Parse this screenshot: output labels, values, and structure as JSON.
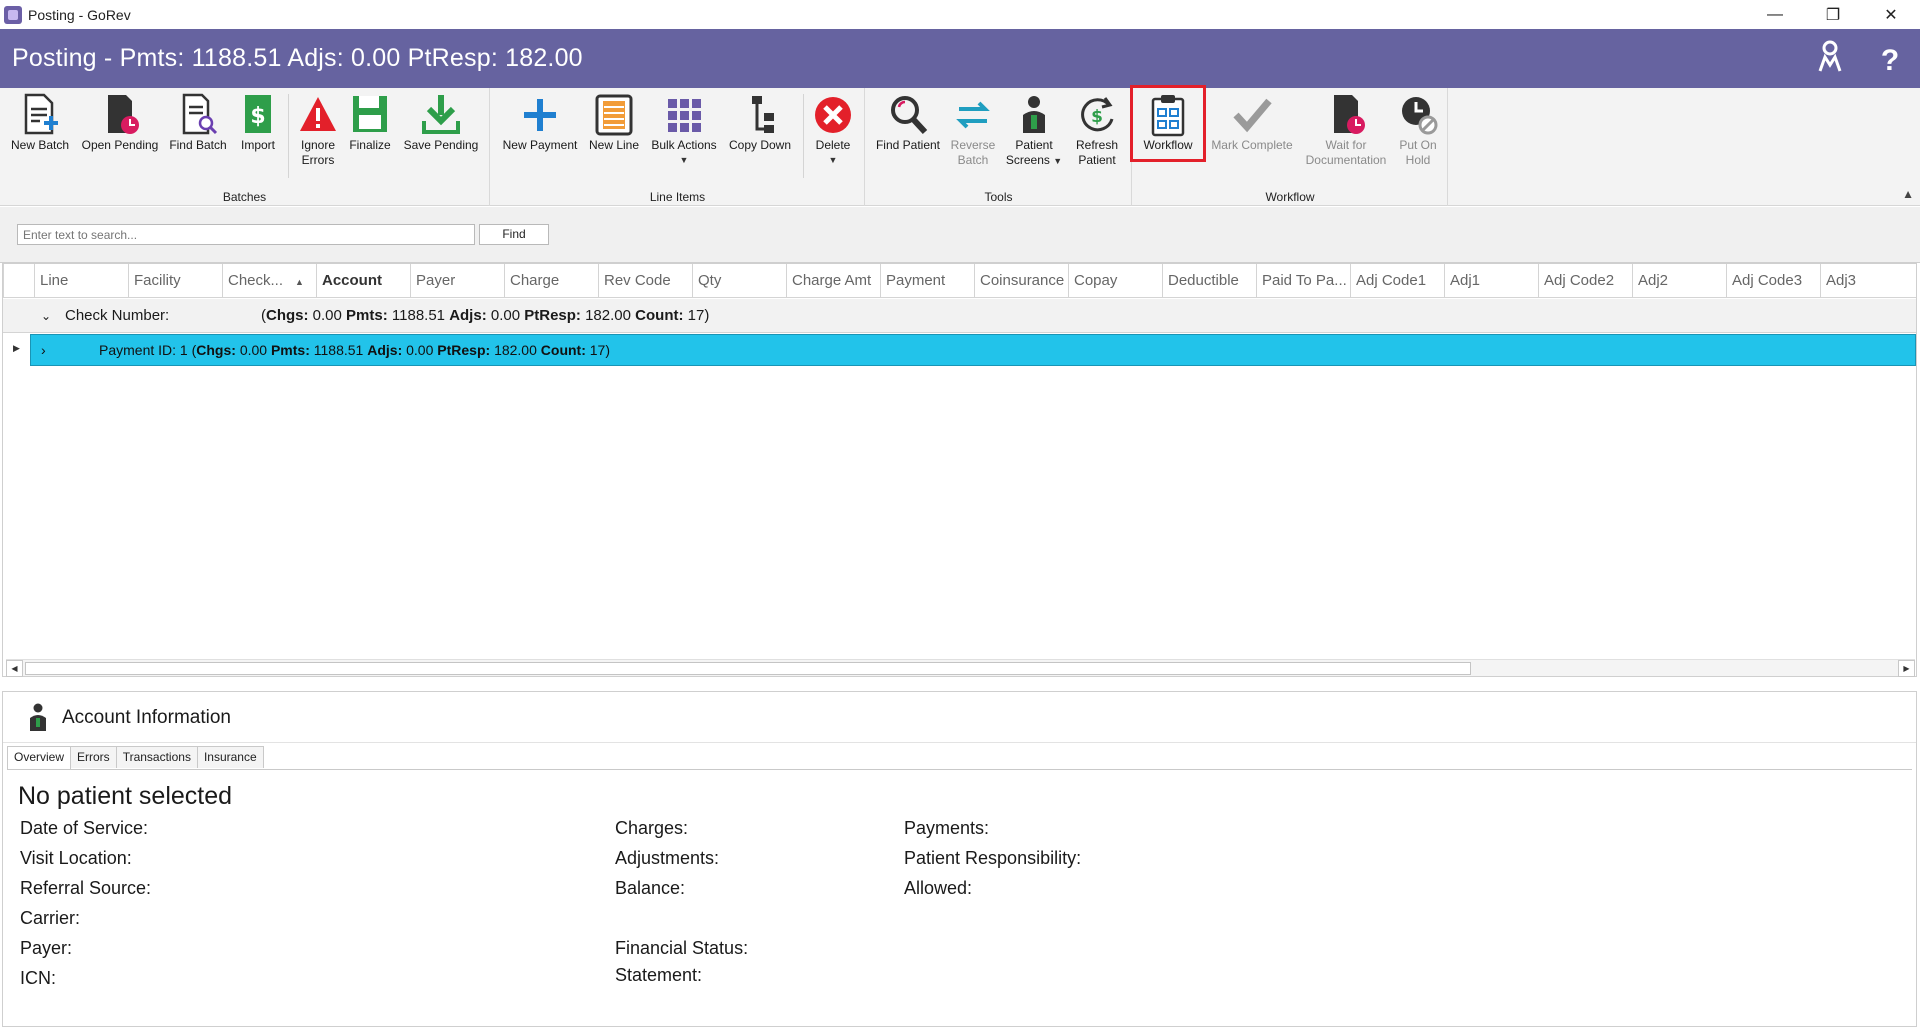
{
  "window": {
    "title": "Posting - GoRev",
    "controls": [
      "—",
      "❐",
      "✕"
    ]
  },
  "header": {
    "title": "Posting - Pmts: 1188.51 Adjs: 0.00 PtResp: 182.00",
    "icons": [
      "users-icon",
      "help-icon"
    ],
    "help_glyph": "?"
  },
  "ribbon": {
    "groups": {
      "batches": "Batches",
      "line_items": "Line Items",
      "tools": "Tools",
      "workflow": "Workflow"
    },
    "buttons": {
      "new_batch": "New Batch",
      "open_pending": "Open Pending",
      "find_batch": "Find Batch",
      "import": "Import",
      "ignore_errors_1": "Ignore",
      "ignore_errors_2": "Errors",
      "finalize": "Finalize",
      "save_pending": "Save Pending",
      "new_payment": "New Payment",
      "new_line": "New Line",
      "bulk_actions": "Bulk Actions",
      "copy_down": "Copy Down",
      "delete": "Delete",
      "find_patient": "Find Patient",
      "reverse_batch_1": "Reverse",
      "reverse_batch_2": "Batch",
      "patient_screens_1": "Patient",
      "patient_screens_2": "Screens",
      "refresh_patient_1": "Refresh",
      "refresh_patient_2": "Patient",
      "workflow": "Workflow",
      "mark_complete": "Mark Complete",
      "wait_doc_1": "Wait for",
      "wait_doc_2": "Documentation",
      "put_on_hold_1": "Put On",
      "put_on_hold_2": "Hold"
    },
    "colors": {
      "header_bg": "#6663a0",
      "selected_row": "#22c3ea",
      "highlight_outline": "#e3202a",
      "delete_red": "#e3202a",
      "finalize_green": "#2e9e4a",
      "blue_action": "#1f7fd0"
    }
  },
  "search": {
    "placeholder": "Enter text to search...",
    "find_label": "Find"
  },
  "grid": {
    "columns": [
      "Line",
      "Facility",
      "Check...",
      "Account",
      "Payer",
      "Charge",
      "Rev Code",
      "Qty",
      "Charge Amt",
      "Payment",
      "Coinsurance",
      "Copay",
      "Deductible",
      "Paid To Pa...",
      "Adj Code1",
      "Adj1",
      "Adj Code2",
      "Adj2",
      "Adj Code3",
      "Adj3"
    ],
    "group_row": {
      "label": "Check Number:",
      "open": "(",
      "chgs_label": "Chgs:",
      "chgs": "0.00",
      "pmts_label": "Pmts:",
      "pmts": "1188.51",
      "adjs_label": "Adjs:",
      "adjs": "0.00",
      "ptresp_label": "PtResp:",
      "ptresp": "182.00",
      "count_label": "Count:",
      "count": "17",
      "close": ")"
    },
    "payment_row": {
      "label": "Payment ID: 1",
      "open": "(",
      "chgs_label": "Chgs:",
      "chgs": "0.00",
      "pmts_label": "Pmts:",
      "pmts": "1188.51",
      "adjs_label": "Adjs:",
      "adjs": "0.00",
      "ptresp_label": "PtResp:",
      "ptresp": "182.00",
      "count_label": "Count:",
      "count": "17",
      "close": ")"
    }
  },
  "account": {
    "title": "Account Information",
    "tabs": [
      "Overview",
      "Errors",
      "Transactions",
      "Insurance"
    ],
    "no_patient": "No patient selected",
    "fields": {
      "date_of_service": "Date of Service:",
      "visit_location": "Visit Location:",
      "referral_source": "Referral Source:",
      "carrier": "Carrier:",
      "payer": "Payer:",
      "icn": "ICN:",
      "charges": "Charges:",
      "adjustments": "Adjustments:",
      "balance": "Balance:",
      "financial_status": "Financial Status:",
      "statement": "Statement:",
      "payments": "Payments:",
      "patient_responsibility": "Patient Responsibility:",
      "allowed": "Allowed:"
    }
  }
}
